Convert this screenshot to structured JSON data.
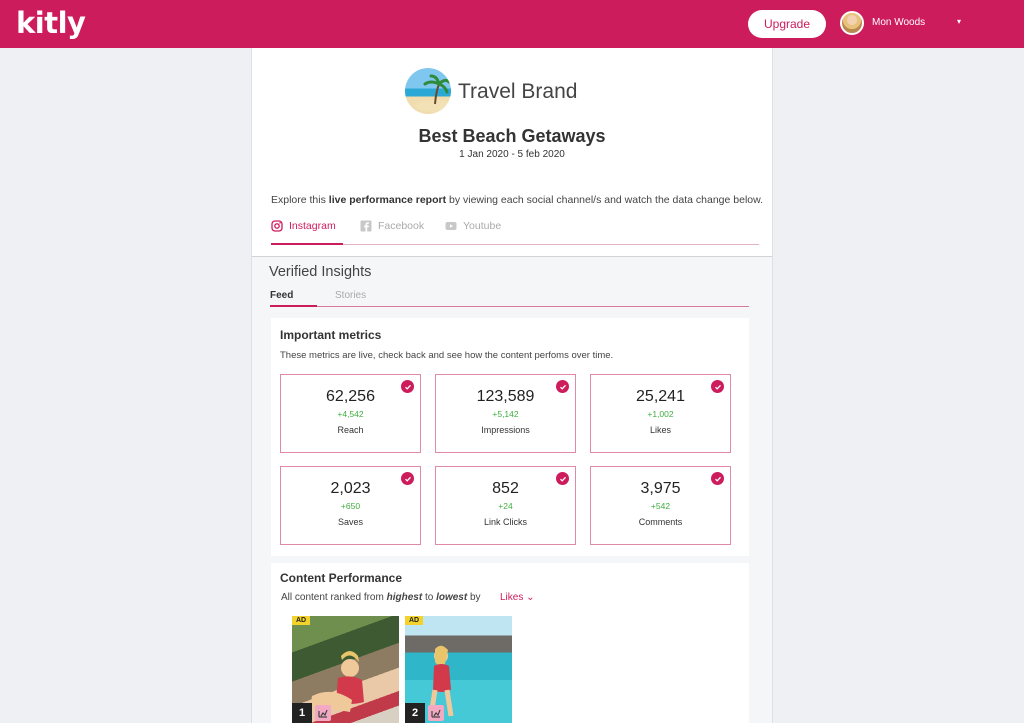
{
  "app": {
    "logo": "kitly",
    "upgrade_label": "Upgrade",
    "user_name": "Mon Woods",
    "user_caret": "▾",
    "accent_color": "#cd1c5c"
  },
  "report": {
    "brand_name": "Travel Brand",
    "campaign_title": "Best Beach Getaways",
    "date_range": "1 Jan 2020 - 5 feb 2020",
    "explore_prefix": "Explore this ",
    "explore_bold": "live performance report",
    "explore_suffix": " by viewing each social channel/s and watch the data change below.",
    "channels": [
      {
        "label": "Instagram",
        "icon": "instagram-icon",
        "active": true
      },
      {
        "label": "Facebook",
        "icon": "facebook-icon",
        "active": false
      },
      {
        "label": "Youtube",
        "icon": "youtube-icon",
        "active": false
      }
    ]
  },
  "insights": {
    "title": "Verified Insights",
    "tabs": [
      {
        "label": "Feed",
        "active": true
      },
      {
        "label": "Stories",
        "active": false
      }
    ]
  },
  "metrics": {
    "title": "Important metrics",
    "description": "These metrics are live, check back and see how the content perfoms over time.",
    "items": [
      {
        "value": "62,256",
        "delta": "+4,542",
        "label": "Reach"
      },
      {
        "value": "123,589",
        "delta": "+5,142",
        "label": "Impressions"
      },
      {
        "value": "25,241",
        "delta": "+1,002",
        "label": "Likes"
      },
      {
        "value": "2,023",
        "delta": "+650",
        "label": "Saves"
      },
      {
        "value": "852",
        "delta": "+24",
        "label": "Link Clicks"
      },
      {
        "value": "3,975",
        "delta": "+542",
        "label": "Comments"
      }
    ],
    "delta_color": "#3fae3f"
  },
  "content": {
    "title": "Content Performance",
    "rank_prefix": "All content ranked from ",
    "rank_high": "highest",
    "rank_mid": " to ",
    "rank_low": "lowest",
    "rank_suffix": " by",
    "sort_value": "Likes",
    "sort_caret": "⌄",
    "posts": [
      {
        "badge": "AD",
        "rank": "1"
      },
      {
        "badge": "AD",
        "rank": "2"
      }
    ]
  }
}
